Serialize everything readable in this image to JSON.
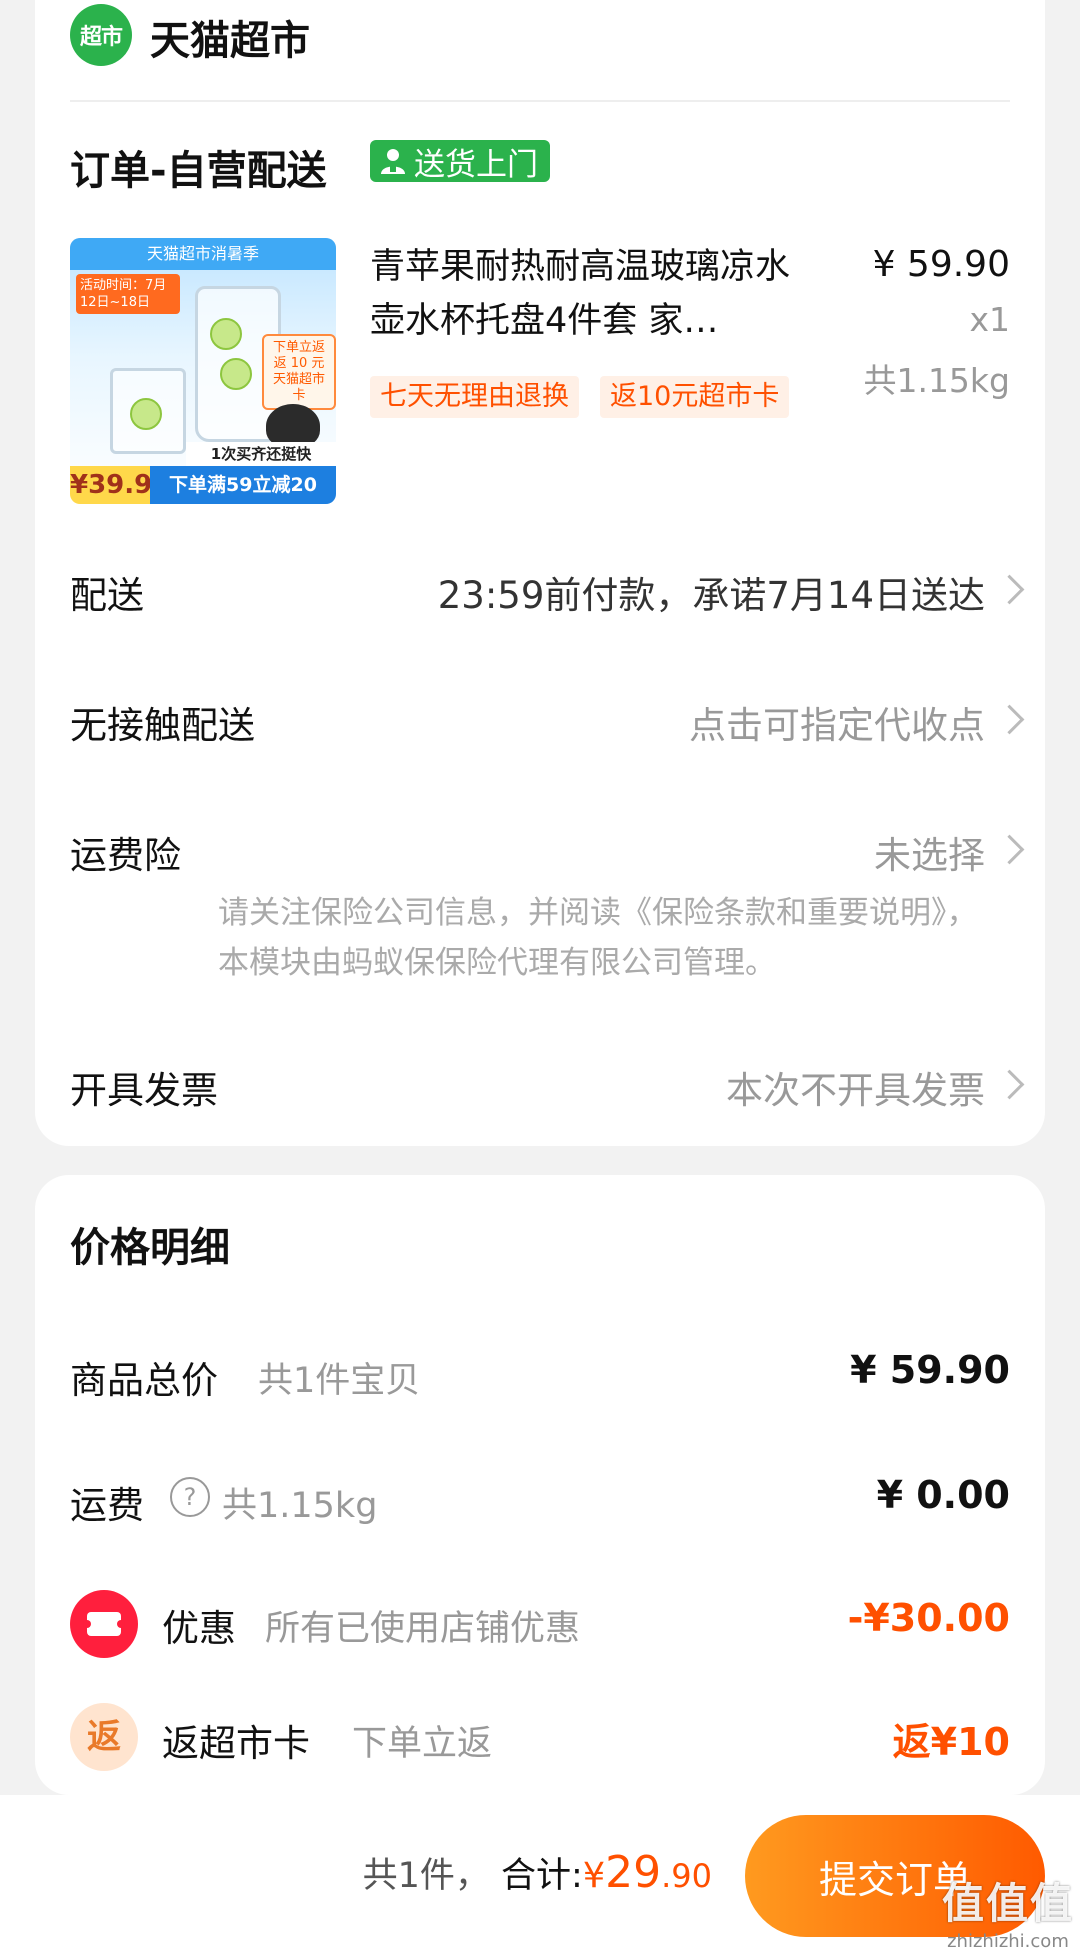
{
  "store": {
    "logo_text": "超市",
    "name": "天猫超市"
  },
  "order": {
    "title": "订单-自营配送",
    "delivery_tag": "送货上门"
  },
  "product": {
    "image": {
      "header": "天猫超市消暑季",
      "activity": "活动时间：7月12日~18日",
      "rebate": "下单立返 返 10 元 天猫超市卡",
      "quick": "1次买齐还挺快",
      "price": "¥39.9",
      "band": "下单满59立减20"
    },
    "title": "青苹果耐热耐高温玻璃凉水壶水杯托盘4件套 家…",
    "price": "¥ 59.90",
    "qty": "x1",
    "weight": "共1.15kg",
    "tags": [
      "七天无理由退换",
      "返10元超市卡"
    ]
  },
  "rows": {
    "delivery": {
      "label": "配送",
      "value": "23:59前付款，承诺7月14日送达"
    },
    "contactless": {
      "label": "无接触配送",
      "value": "点击可指定代收点"
    },
    "insurance": {
      "label": "运费险",
      "value": "未选择",
      "note": "请关注保险公司信息，并阅读《保险条款和重要说明》，本模块由蚂蚁保保险代理有限公司管理。"
    },
    "invoice": {
      "label": "开具发票",
      "value": "本次不开具发票"
    }
  },
  "price_detail": {
    "title": "价格明细",
    "goods_total": {
      "label": "商品总价",
      "sub": "共1件宝贝",
      "value": "¥ 59.90"
    },
    "shipping": {
      "label": "运费",
      "help": "?",
      "sub": "共1.15kg",
      "value": "¥ 0.00"
    },
    "discount": {
      "label": "优惠",
      "sub": "所有已使用店铺优惠",
      "value": "-¥30.00"
    },
    "rebate": {
      "icon_text": "返",
      "label": "返超市卡",
      "sub": "下单立返",
      "value": "返¥10"
    }
  },
  "footer": {
    "count": "共1件，",
    "total_label": "合计:",
    "currency": "¥",
    "total_int": "29",
    "total_dec": ".90",
    "submit": "提交订单"
  },
  "watermark": {
    "logo": "值值值",
    "url": "zhizhizhi.com"
  },
  "colors": {
    "brand_green": "#2bb24c",
    "accent_orange": "#ff5000",
    "discount_red": "#ff1f3d"
  }
}
